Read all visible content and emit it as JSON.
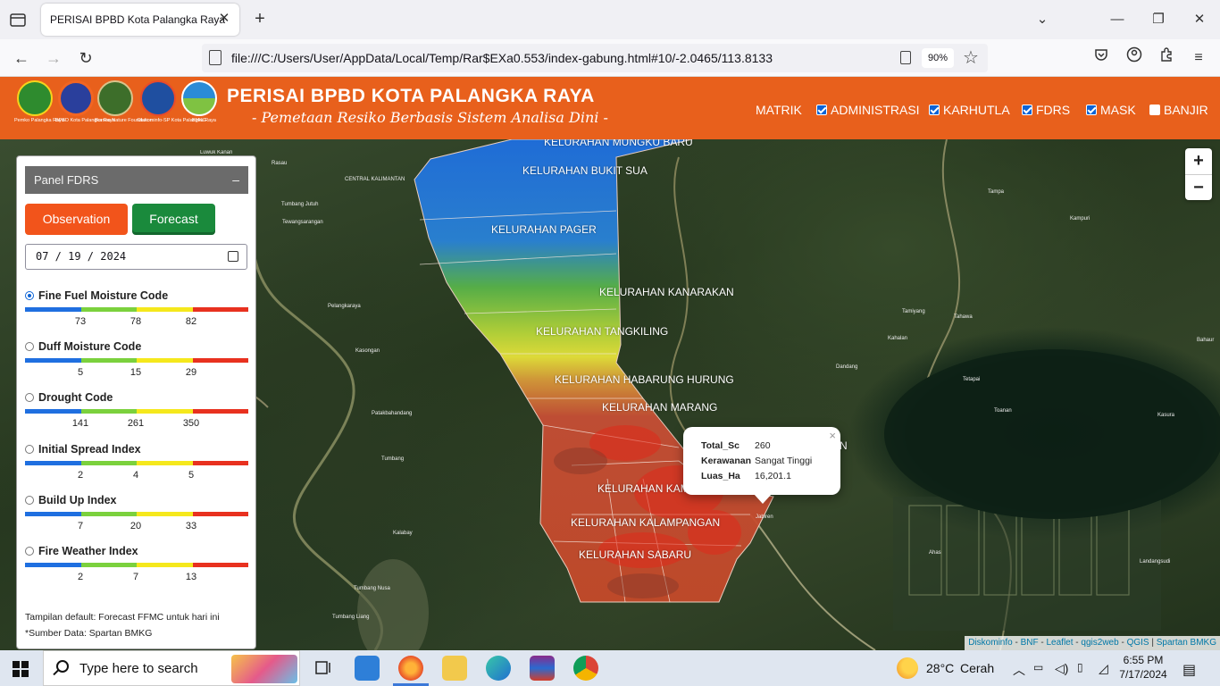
{
  "browser": {
    "tab_title": "PERISAI BPBD Kota Palangka Raya",
    "url": "file:///C:/Users/User/AppData/Local/Temp/Rar$EXa0.553/index-gabung.html#10/-2.0465/113.8133",
    "zoom": "90%"
  },
  "header": {
    "title": "PERISAI BPBD KOTA PALANGKA RAYA",
    "subtitle": "- Pemetaan Resiko Berbasis Sistem Analisa Dini -",
    "logos": [
      {
        "caption": "Pemko Palangka Raya",
        "icon": "pemko-logo-icon",
        "color": "#2e8b2e"
      },
      {
        "caption": "BPBD Kota Palangka Raya",
        "icon": "bpbd-logo-icon",
        "color": "#2a3f9c"
      },
      {
        "caption": "Borneo Nature Foundation",
        "icon": "bnf-logo-icon",
        "color": "#3d6e2a"
      },
      {
        "caption": "Diskominfo-SP Kota Palangka Raya",
        "icon": "diskominfo-logo-icon",
        "color": "#1f4fa0"
      },
      {
        "caption": "BMKG",
        "icon": "bmkg-logo-icon",
        "color": "#2a8bd6"
      }
    ],
    "menu": {
      "matrik": "MATRIK",
      "administrasi": "ADMINISTRASI",
      "karhutla": "KARHUTLA",
      "fdrs": "FDRS",
      "mask": "MASK",
      "banjir": "BANJIR"
    },
    "menu_checked": {
      "administrasi": true,
      "karhutla": true,
      "fdrs": true,
      "mask": true,
      "banjir": false
    }
  },
  "panel": {
    "title": "Panel FDRS",
    "minimize": "–",
    "observation_label": "Observation",
    "forecast_label": "Forecast",
    "date_value": "07 / 19 / 2024",
    "indices": [
      {
        "label": "Fine Fuel Moisture Code",
        "selected": true,
        "ticks": [
          "73",
          "78",
          "82"
        ]
      },
      {
        "label": "Duff Moisture Code",
        "selected": false,
        "ticks": [
          "5",
          "15",
          "29"
        ]
      },
      {
        "label": "Drought Code",
        "selected": false,
        "ticks": [
          "141",
          "261",
          "350"
        ]
      },
      {
        "label": "Initial Spread Index",
        "selected": false,
        "ticks": [
          "2",
          "4",
          "5"
        ]
      },
      {
        "label": "Build Up Index",
        "selected": false,
        "ticks": [
          "7",
          "20",
          "33"
        ]
      },
      {
        "label": "Fire Weather Index",
        "selected": false,
        "ticks": [
          "2",
          "7",
          "13"
        ]
      }
    ],
    "scale_colors": [
      "#1f6fe0",
      "#7bd13d",
      "#f5e81c",
      "#e8311f"
    ],
    "note_default": "Tampilan default: Forecast FFMC untuk hari ini",
    "note_source": "*Sumber Data: Spartan BMKG"
  },
  "map": {
    "kelurahan": [
      "KELURAHAN MUNGKU BARU",
      "KELURAHAN BUKIT SUA",
      "KELURAHAN PAGER",
      "KELURAHAN KANARAKAN",
      "KELURAHAN TANGKILING",
      "KELURAHAN HABARUNG HURUNG",
      "KELURAHAN MARANG",
      "KELURAHAN KAM",
      "KELURAHAN KALAMPANGAN",
      "KELURAHAN SABARU",
      "N"
    ],
    "places": [
      "Rasau",
      "Luwuk Kanan",
      "CENTRAL KALIMANTAN",
      "Tumbang Jutuh",
      "Tewangsarangan",
      "Pelangkaraya",
      "Kasongan",
      "Patakbahandang",
      "Tumbang",
      "Kalabay",
      "Tumbang Liang",
      "Tumbang Nusa",
      "Jabiren",
      "Tampa",
      "Kampuri",
      "Bahaur",
      "Ahas",
      "Tahawa",
      "Tetapai",
      "Landangsudi",
      "Tamiyang",
      "Dandang",
      "Kahalan",
      "Toanan",
      "Kasura"
    ],
    "popup": {
      "close": "×",
      "rows": [
        {
          "key": "Total_Sc",
          "value": "260"
        },
        {
          "key": "Kerawanan",
          "value": "Sangat Tinggi"
        },
        {
          "key": "Luas_Ha",
          "value": "16,201.1"
        }
      ]
    },
    "zoom_in": "+",
    "zoom_out": "−",
    "attribution": [
      "Diskominfo",
      "BNF",
      "Leaflet",
      "qgis2web",
      "QGIS",
      "Spartan BMKG"
    ]
  },
  "taskbar": {
    "search_placeholder": "Type here to search",
    "weather_temp": "28°C",
    "weather_text": "Cerah",
    "time": "6:55 PM",
    "date": "7/17/2024"
  }
}
